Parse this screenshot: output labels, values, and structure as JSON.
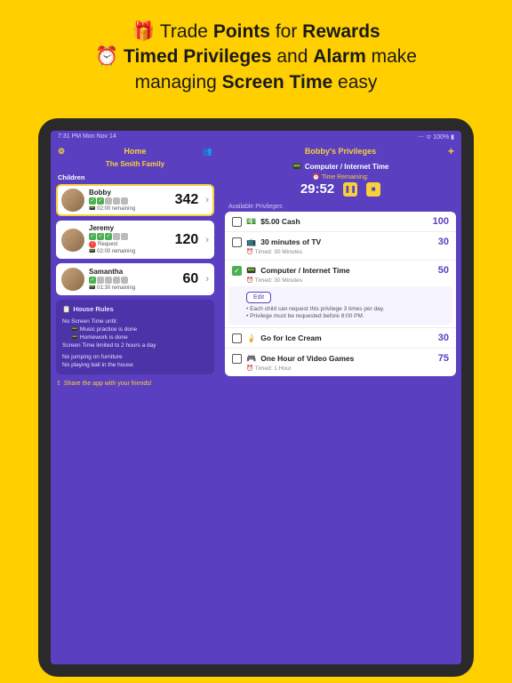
{
  "promo": {
    "l1a": "🎁 Trade ",
    "l1b": "Points",
    "l1c": " for ",
    "l1d": "Rewards",
    "l2a": "⏰ ",
    "l2b": "Timed Privileges",
    "l2c": " and ",
    "l2d": "Alarm",
    "l2e": " make",
    "l3a": "managing ",
    "l3b": "Screen Time",
    "l3c": " easy"
  },
  "status": {
    "left": "7:31 PM    Mon Nov 14",
    "right": "⋯ ᯤ 100% ▮"
  },
  "left_nav": {
    "gear": "⚙",
    "title": "Home",
    "icon": "👥"
  },
  "right_nav": {
    "title": "Bobby's Privileges",
    "plus": "+"
  },
  "family": "The Smith Family",
  "section_children": "Children",
  "children": [
    {
      "name": "Bobby",
      "points": "342",
      "remaining": "📟 02:00 remaining",
      "badges": [
        "g",
        "g",
        "x",
        "x",
        "x"
      ]
    },
    {
      "name": "Jeremy",
      "points": "120",
      "remaining": "📟 02:00 remaining",
      "request": "Request",
      "badges": [
        "g",
        "g",
        "g",
        "x",
        "x"
      ]
    },
    {
      "name": "Samantha",
      "points": "60",
      "remaining": "📟 01:30 remaining",
      "badges": [
        "g",
        "x",
        "x",
        "x",
        "x"
      ]
    }
  ],
  "rules": {
    "title": "House Rules",
    "l1": "No Screen Time until:",
    "l2": "Music practice is done",
    "l3": "Homework is done",
    "l4": "Screen Time limited to 2 hours a day",
    "l5": "No jumping on furniture",
    "l6": "No playing ball in the house"
  },
  "share": "Share the app with your friends!",
  "timer": {
    "title": "Computer / Internet Time",
    "label": "⏰  Time Remaining:",
    "value": "29:52"
  },
  "section_available": "Available Privileges",
  "privs": [
    {
      "icon": "💵",
      "title": "$5.00 Cash",
      "cost": "100"
    },
    {
      "icon": "📺",
      "title": "30 minutes of TV",
      "cost": "30",
      "meta": "⏰ Timed: 30 Minutes"
    },
    {
      "icon": "📟",
      "title": "Computer / Internet Time",
      "cost": "50",
      "meta": "⏰ Timed: 30 Minutes",
      "checked": true,
      "edit": "Edit",
      "b1": "Each child can request this privilege 3 times per day.",
      "b2": "Privilege must be requested before 8:00 PM."
    },
    {
      "icon": "🍦",
      "title": "Go for Ice Cream",
      "cost": "30"
    },
    {
      "icon": "🎮",
      "title": "One Hour of Video Games",
      "cost": "75",
      "meta": "⏰ Timed: 1 Hour"
    }
  ]
}
